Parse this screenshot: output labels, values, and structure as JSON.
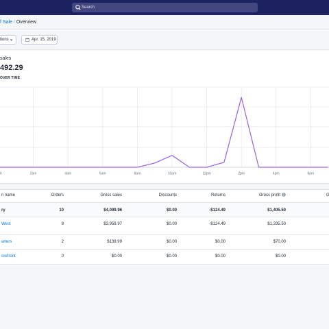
{
  "search": {
    "placeholder": "Search"
  },
  "breadcrumb": {
    "parent": "f Sale",
    "separator": "/",
    "current": "Overview"
  },
  "filters": {
    "locations_label": "tions",
    "date_label": "Apr. 15, 2019"
  },
  "sales_card": {
    "title": "sales",
    "total": "492.29",
    "chart_heading": "OVER TIME"
  },
  "chart_data": {
    "type": "line",
    "x_tick_labels": [
      "6",
      "2am",
      "4am",
      "6am",
      "8am",
      "10am",
      "12pm",
      "2pm",
      "4pm",
      "6pm"
    ],
    "series": [
      {
        "color": "#9c6ade",
        "points": [
          {
            "x": "12am",
            "y": 0
          },
          {
            "x": "2am",
            "y": 0
          },
          {
            "x": "4am",
            "y": 0
          },
          {
            "x": "6am",
            "y": 0
          },
          {
            "x": "8am",
            "y": 0
          },
          {
            "x": "9am",
            "y": 0.06
          },
          {
            "x": "10am",
            "y": 0.17
          },
          {
            "x": "11am",
            "y": 0
          },
          {
            "x": "12pm",
            "y": 0
          },
          {
            "x": "1pm",
            "y": 0.07
          },
          {
            "x": "2pm",
            "y": 1.0
          },
          {
            "x": "3pm",
            "y": 0
          },
          {
            "x": "4pm",
            "y": 0
          },
          {
            "x": "6pm",
            "y": 0
          },
          {
            "x": "7pm",
            "y": 0
          }
        ]
      }
    ],
    "grid": true,
    "legend": "none"
  },
  "table": {
    "headers": [
      "n name",
      "Orders",
      "Gross sales",
      "Discounts",
      "Returns",
      "Gross profit",
      "G"
    ],
    "total_row": [
      "ry",
      "10",
      "$4,099.96",
      "$0.00",
      "-$124.49",
      "$1,405.50"
    ],
    "rows": [
      [
        "West",
        "8",
        "$3,959.97",
        "$0.00",
        "-$124.49",
        "$1,335.50"
      ],
      [
        "arters",
        "2",
        "$139.99",
        "$0.00",
        "$0.00",
        "$70.00"
      ],
      [
        "orefront",
        "0",
        "$0.00",
        "$0.00",
        "$0.00",
        "$0.00"
      ]
    ]
  },
  "colors": {
    "topbar": "#1c2260",
    "accent_line": "#9c6ade",
    "link": "#007ace"
  }
}
